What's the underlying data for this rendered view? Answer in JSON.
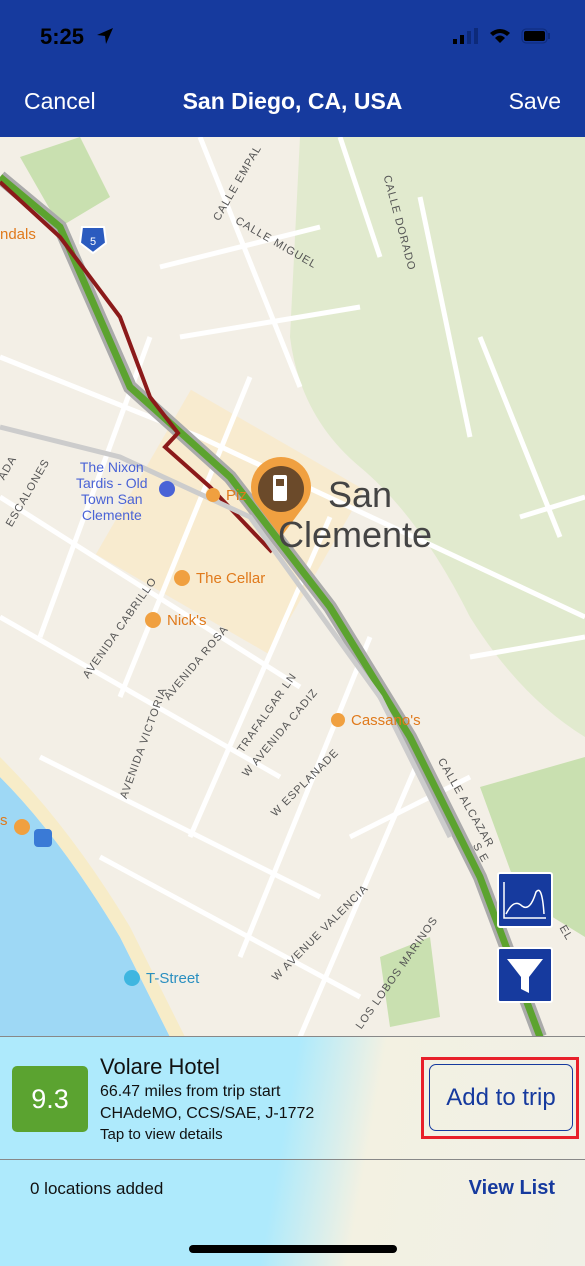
{
  "status_bar": {
    "time": "5:25"
  },
  "nav": {
    "cancel": "Cancel",
    "title": "San Diego, CA, USA",
    "save": "Save"
  },
  "map": {
    "city_line1": "San",
    "city_line2": "Clemente",
    "highway_shield": "5",
    "pois": {
      "partial_left": "ndals",
      "nixon": "The Nixon\nTardis - Old\nTown San\nClemente",
      "pizza": "Piz",
      "cellar": "The Cellar",
      "nicks": "Nick's",
      "cassanos": "Cassano's",
      "tstreet": "T-Street",
      "partial_left2": "s"
    },
    "streets": {
      "empalme": "CALLE EMPAL",
      "dorado": "CALLE DORADO",
      "miguel": "CALLE MIGUEL",
      "escalones": "ESCALONES",
      "ada": "ADA",
      "cabrillo": "AVENIDA CABRILLO",
      "rosa": "AVENIDA ROSA",
      "victoria": "AVENIDA VICTORIA",
      "trafalgar": "TRAFALGAR LN",
      "cadiz": "W AVENIDA CADIZ",
      "esplanade": "W ESPLANADE",
      "alcazar": "CALLE ALCAZAR",
      "se": "S E",
      "valencia": "W AVENUE VALENCIA",
      "lobos": "LOS LOBOS MARINOS",
      "el": "EL"
    },
    "colors": {
      "route_green": "#5ca32f",
      "route_red": "#8b1a1a",
      "pin": "#f0a040",
      "water": "#9ed8f5"
    },
    "buttons": {
      "elevation": "chart-icon",
      "filter": "filter-icon"
    }
  },
  "location": {
    "score": "9.3",
    "name": "Volare Hotel",
    "distance": "66.47 miles from trip start",
    "connectors": "CHAdeMO, CCS/SAE, J-1772",
    "hint": "Tap to view details",
    "add_button": "Add to trip"
  },
  "footer": {
    "count": "0 locations added",
    "view_list": "View List"
  },
  "colors": {
    "brand": "#163a9e",
    "score_bg": "#5ba330",
    "highlight": "#e8202a"
  }
}
